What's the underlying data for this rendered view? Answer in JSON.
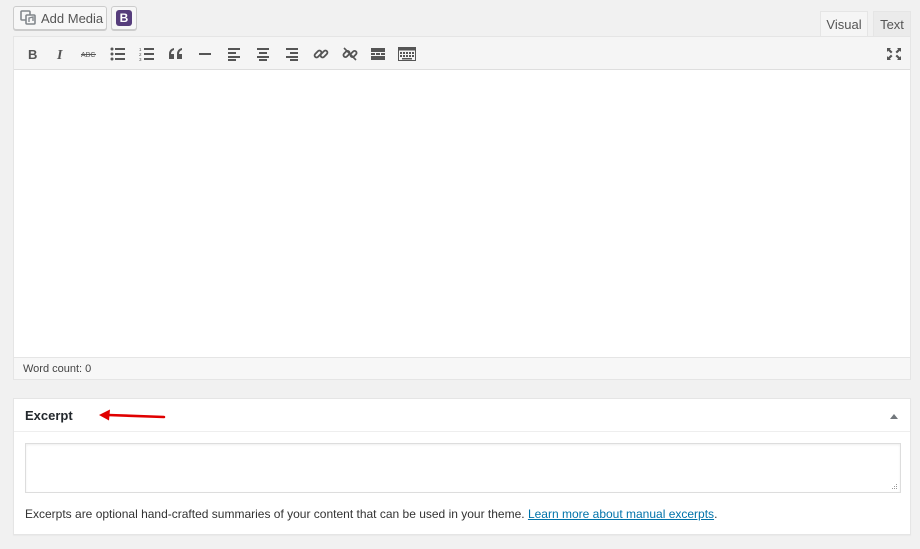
{
  "top": {
    "add_media_label": "Add Media",
    "bootstrap_button_letter": "B",
    "tabs": [
      {
        "label": "Visual",
        "active": true
      },
      {
        "label": "Text",
        "active": false
      }
    ]
  },
  "toolbar": {
    "buttons": [
      {
        "name": "bold-icon",
        "glyph": "B"
      },
      {
        "name": "italic-icon",
        "glyph": "I"
      },
      {
        "name": "strikethrough-icon",
        "glyph": "ABC"
      },
      {
        "name": "bulleted-list-icon"
      },
      {
        "name": "numbered-list-icon"
      },
      {
        "name": "blockquote-icon"
      },
      {
        "name": "horizontal-line-icon"
      },
      {
        "name": "align-left-icon"
      },
      {
        "name": "align-center-icon"
      },
      {
        "name": "align-right-icon"
      },
      {
        "name": "insert-link-icon"
      },
      {
        "name": "remove-link-icon"
      },
      {
        "name": "read-more-icon"
      },
      {
        "name": "toolbar-toggle-icon"
      }
    ],
    "fullscreen_icon": "fullscreen-icon"
  },
  "editor": {
    "word_count": "Word count: 0"
  },
  "excerpt": {
    "title": "Excerpt",
    "textarea_value": "",
    "description": "Excerpts are optional hand-crafted summaries of your content that can be used in your theme. ",
    "link_text": "Learn more about manual excerpts",
    "after_link": "."
  },
  "colors": {
    "accent_link": "#0073aa",
    "bootstrap_purple": "#563d7c",
    "annotation_red": "#e00000"
  }
}
